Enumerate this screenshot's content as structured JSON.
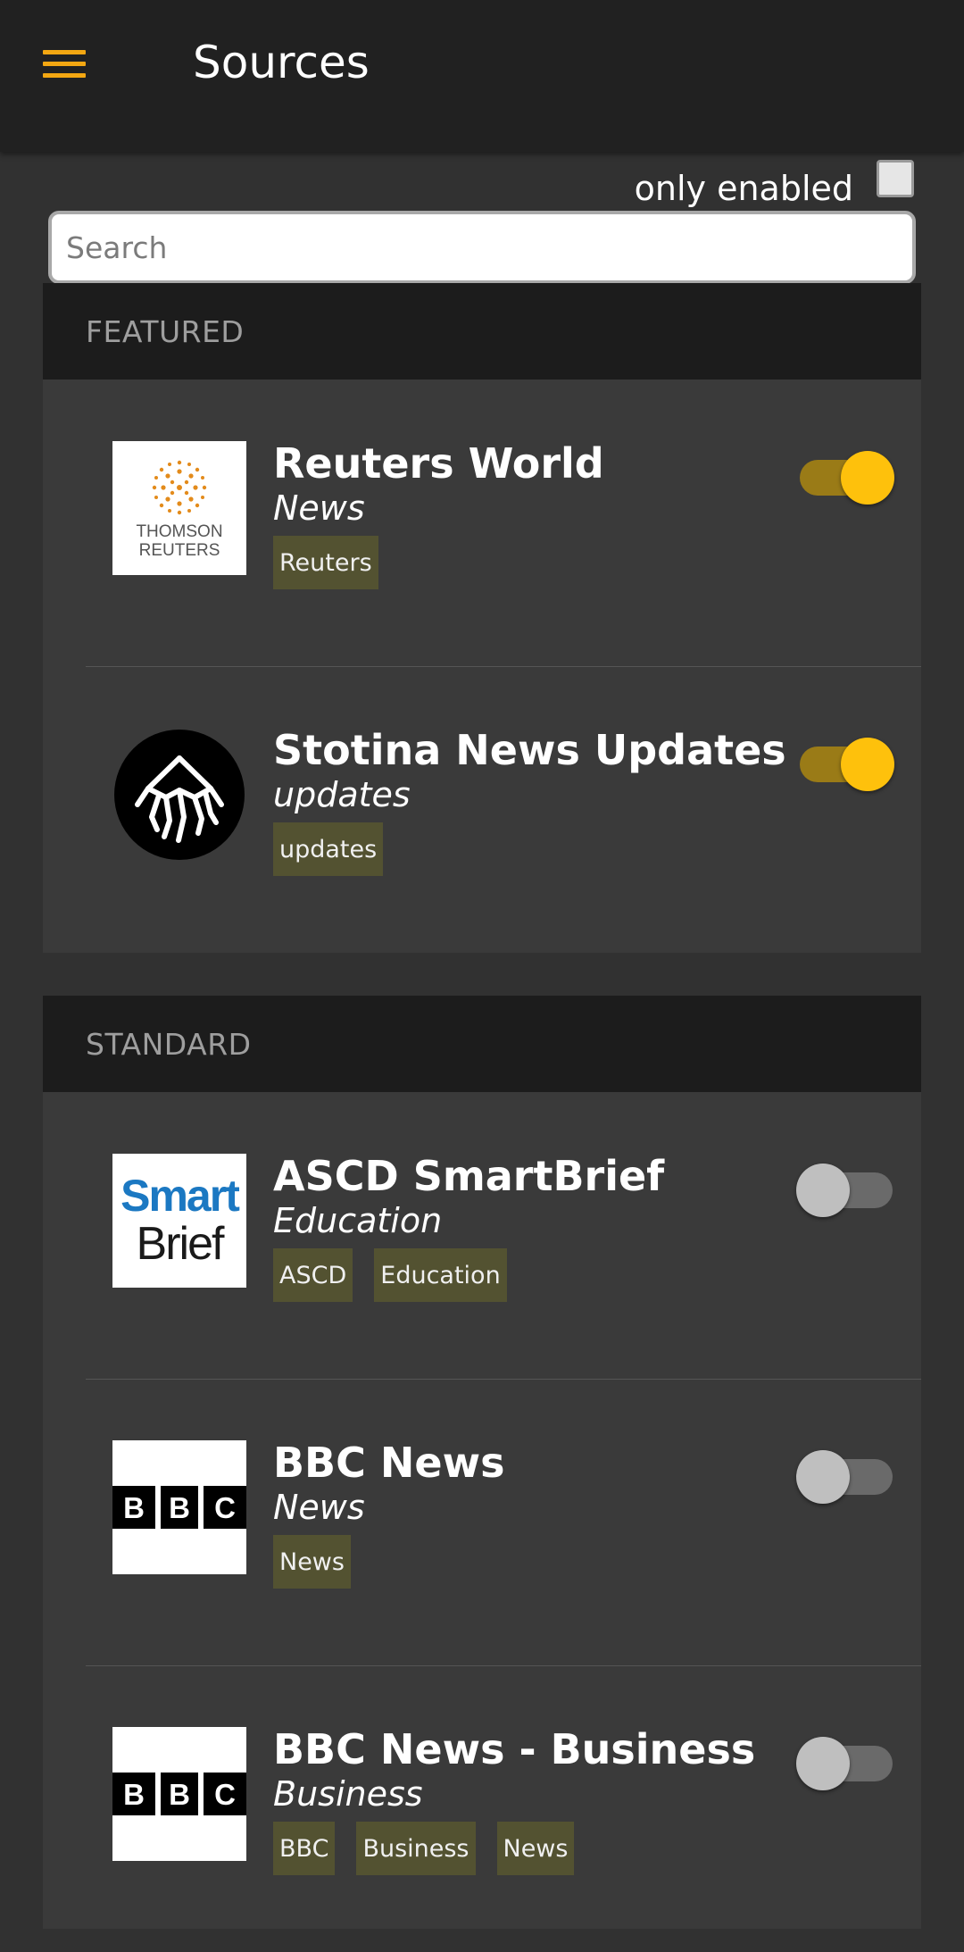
{
  "appbar": {
    "title": "Sources",
    "menu_icon": "hamburger-icon",
    "accent": "#f3a712"
  },
  "filter": {
    "label": "only enabled",
    "checked": false
  },
  "search": {
    "placeholder": "Search",
    "value": ""
  },
  "sections": [
    {
      "title": "FEATURED",
      "items": [
        {
          "title": "Reuters World",
          "subtitle": "News",
          "tags": [
            "Reuters"
          ],
          "enabled": true,
          "logo": "thomson-reuters-logo",
          "logo_text": [
            "THOMSON",
            "REUTERS"
          ]
        },
        {
          "title": "Stotina News Updates",
          "subtitle": "updates",
          "tags": [
            "updates"
          ],
          "enabled": true,
          "logo": "stotina-logo"
        }
      ]
    },
    {
      "title": "STANDARD",
      "items": [
        {
          "title": "ASCD SmartBrief",
          "subtitle": "Education",
          "tags": [
            "ASCD",
            "Education"
          ],
          "enabled": false,
          "logo": "smartbrief-logo",
          "logo_text": [
            "Smart",
            "Brief"
          ]
        },
        {
          "title": "BBC News",
          "subtitle": "News",
          "tags": [
            "News"
          ],
          "enabled": false,
          "logo": "bbc-logo",
          "logo_text": [
            "B",
            "B",
            "C"
          ]
        },
        {
          "title": "BBC News - Business",
          "subtitle": "Business",
          "tags": [
            "BBC",
            "Business",
            "News"
          ],
          "enabled": false,
          "logo": "bbc-logo",
          "logo_text": [
            "B",
            "B",
            "C"
          ]
        }
      ]
    }
  ],
  "colors": {
    "toggle_on_knob": "#fec10c",
    "toggle_on_track": "#9a7b17",
    "toggle_off_knob": "#bfbfbf",
    "tag_bg": "#535231"
  }
}
